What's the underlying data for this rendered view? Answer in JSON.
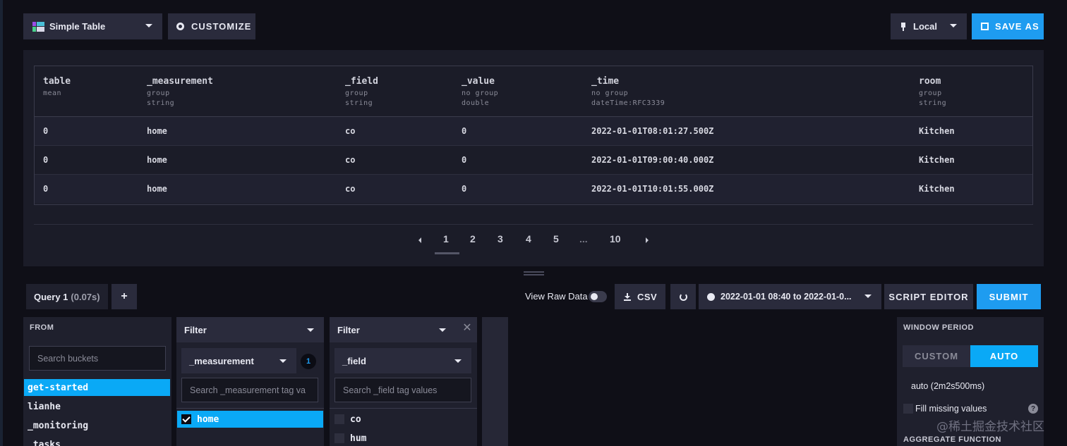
{
  "toolbar": {
    "visualization": "Simple Table",
    "customize": "CUSTOMIZE",
    "timezone": "Local",
    "save_as": "SAVE AS"
  },
  "table": {
    "columns": [
      {
        "name": "table",
        "group": "mean",
        "type": ""
      },
      {
        "name": "_measurement",
        "group": "group",
        "type": "string"
      },
      {
        "name": "_field",
        "group": "group",
        "type": "string"
      },
      {
        "name": "_value",
        "group": "no group",
        "type": "double"
      },
      {
        "name": "_time",
        "group": "no group",
        "type": "dateTime:RFC3339"
      },
      {
        "name": "room",
        "group": "group",
        "type": "string"
      }
    ],
    "rows": [
      [
        "0",
        "home",
        "co",
        "0",
        "2022-01-01T08:01:27.500Z",
        "Kitchen"
      ],
      [
        "0",
        "home",
        "co",
        "0",
        "2022-01-01T09:00:40.000Z",
        "Kitchen"
      ],
      [
        "0",
        "home",
        "co",
        "0",
        "2022-01-01T10:01:55.000Z",
        "Kitchen"
      ]
    ]
  },
  "pagination": {
    "pages": [
      "1",
      "2",
      "3",
      "4",
      "5",
      "...",
      "10"
    ],
    "current": "1"
  },
  "query": {
    "tab_label": "Query 1",
    "tab_time": "(0.07s)",
    "add": "+",
    "view_raw": "View Raw Data",
    "csv": "CSV",
    "time_range": "2022-01-01 08:40 to 2022-01-0...",
    "script_editor": "SCRIPT EDITOR",
    "submit": "SUBMIT"
  },
  "from": {
    "title": "FROM",
    "search_placeholder": "Search buckets",
    "buckets": [
      "get-started",
      "lianhe",
      "_monitoring",
      "_tasks"
    ],
    "selected": "get-started"
  },
  "filter1": {
    "title": "Filter",
    "key": "_measurement",
    "count": "1",
    "search_placeholder": "Search _measurement tag va",
    "values": [
      "home"
    ],
    "selected": "home"
  },
  "filter2": {
    "title": "Filter",
    "key": "_field",
    "close": "✕",
    "search_placeholder": "Search _field tag values",
    "values": [
      "co",
      "hum"
    ]
  },
  "window_period": {
    "title": "WINDOW PERIOD",
    "custom": "CUSTOM",
    "auto": "AUTO",
    "value": "auto (2m2s500ms)",
    "fill_missing": "Fill missing values",
    "help": "?",
    "aggregate_title": "AGGREGATE FUNCTION"
  },
  "watermark": "@稀土掘金技术社区",
  "colors": {
    "accent": "#0aa9f6",
    "button_primary": "#1e9cf0",
    "panel": "#1b1c28",
    "background": "#0f0f17"
  }
}
